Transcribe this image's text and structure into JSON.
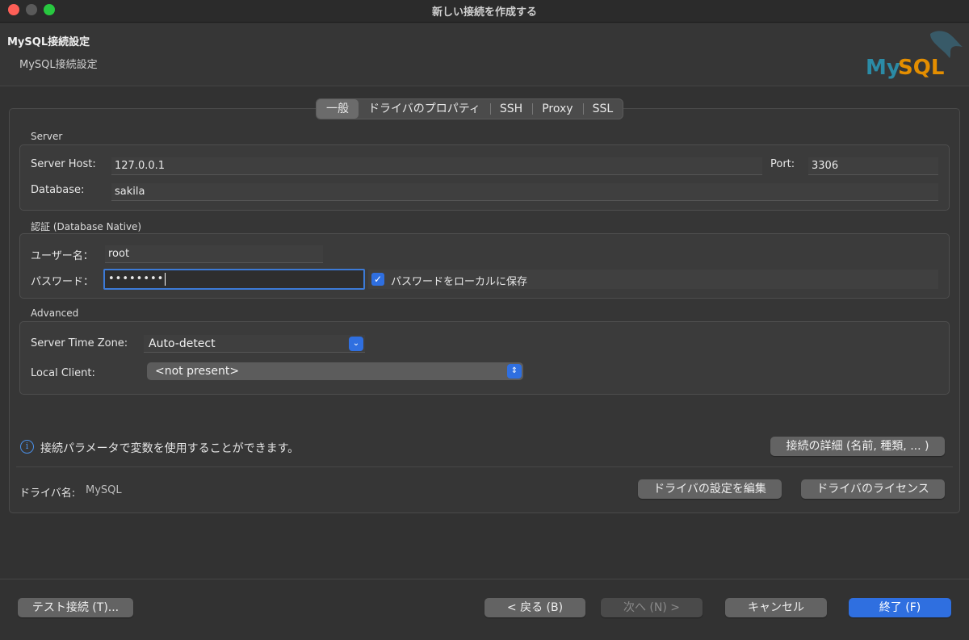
{
  "window": {
    "title": "新しい接続を作成する"
  },
  "header": {
    "title": "MySQL接続設定",
    "subtitle": "MySQL接続設定",
    "logo_text": "MySQL"
  },
  "tabs": [
    {
      "label": "一般",
      "selected": true
    },
    {
      "label": "ドライバのプロパティ",
      "selected": false
    },
    {
      "label": "SSH",
      "selected": false
    },
    {
      "label": "Proxy",
      "selected": false
    },
    {
      "label": "SSL",
      "selected": false
    }
  ],
  "server": {
    "section": "Server",
    "host_label": "Server Host:",
    "host_value": "127.0.0.1",
    "port_label": "Port:",
    "port_value": "3306",
    "database_label": "Database:",
    "database_value": "sakila"
  },
  "auth": {
    "section": "認証 (Database Native)",
    "user_label": "ユーザー名：",
    "user_value": "root",
    "password_label": "パスワード：",
    "password_value": "••••••••",
    "save_password_label": "パスワードをローカルに保存",
    "save_password_checked": true
  },
  "advanced": {
    "section": "Advanced",
    "timezone_label": "Server Time Zone:",
    "timezone_value": "Auto-detect",
    "local_client_label": "Local Client:",
    "local_client_value": "<not present>"
  },
  "info": {
    "text": "接続パラメータで変数を使用することができます。",
    "details_button": "接続の詳細 (名前, 種類, ... )"
  },
  "driver": {
    "label": "ドライバ名:",
    "value": "MySQL",
    "edit_button": "ドライバの設定を編集",
    "license_button": "ドライバのライセンス"
  },
  "footer": {
    "test_button": "テスト接続 (T)...",
    "back_button": "< 戻る (B)",
    "next_button": "次へ (N) >",
    "cancel_button": "キャンセル",
    "finish_button": "終了 (F)"
  },
  "colors": {
    "accent": "#2f6fe0",
    "background": "#323232",
    "mysql_blue": "#2b8ba6",
    "mysql_orange": "#e48e00"
  }
}
